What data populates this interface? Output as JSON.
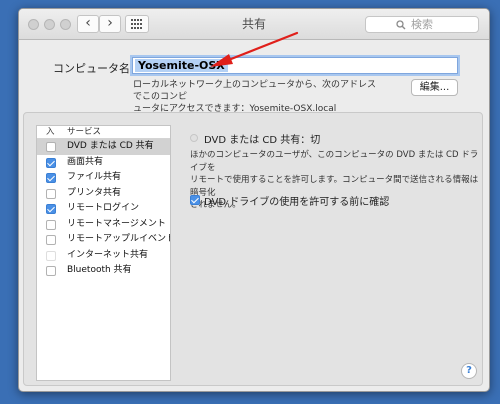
{
  "window": {
    "title": "共有",
    "nav_back_icon": "chevron-left-icon",
    "nav_forward_icon": "chevron-right-icon",
    "grid_icon": "grid-icon",
    "search_placeholder": "検索"
  },
  "computer_name": {
    "label": "コンピュータ名：",
    "value": "Yosemite-OSX",
    "note_line1": "ローカルネットワーク上のコンピュータから、次のアドレスでこのコンピ",
    "note_line2": "ュータにアクセスできます：Yosemite-OSX.local",
    "edit_button": "編集..."
  },
  "services": {
    "header_on": "入",
    "header_service": "サービス",
    "items": [
      {
        "label": "DVD または CD 共有",
        "checked": false,
        "selected": true
      },
      {
        "label": "画面共有",
        "checked": true,
        "selected": false
      },
      {
        "label": "ファイル共有",
        "checked": true,
        "selected": false
      },
      {
        "label": "プリンタ共有",
        "checked": false,
        "selected": false
      },
      {
        "label": "リモートログイン",
        "checked": true,
        "selected": false
      },
      {
        "label": "リモートマネージメント",
        "checked": false,
        "selected": false
      },
      {
        "label": "リモートアップルイベント",
        "checked": false,
        "selected": false
      },
      {
        "label": "インターネット共有",
        "checked": false,
        "selected": false
      },
      {
        "label": "Bluetooth 共有",
        "checked": false,
        "selected": false
      }
    ]
  },
  "detail": {
    "status": "DVD または CD 共有：切",
    "desc_line1": "ほかのコンピュータのユーザが、このコンピュータの DVD または CD ドライブを",
    "desc_line2": "リモートで使用することを許可します。コンピュータ間で送信される情報は暗号化",
    "desc_line3": "されません。",
    "confirm_label": "DVD ドライブの使用を許可する前に確認",
    "confirm_checked": true,
    "help": "?"
  },
  "colors": {
    "desktop": "#3a6fb5",
    "accent": "#4a90e6",
    "annotation_arrow": "#e0201b"
  }
}
